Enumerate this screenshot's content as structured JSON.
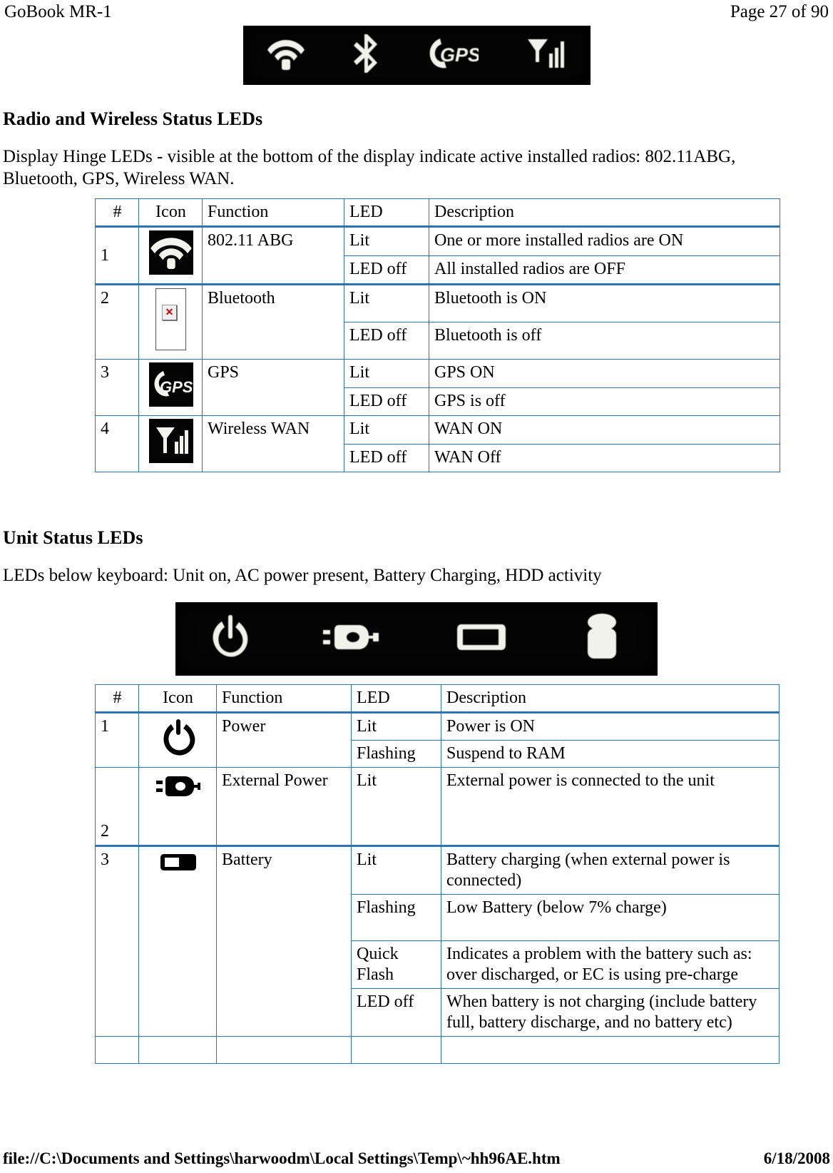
{
  "header": {
    "document_title": "GoBook MR-1",
    "page_label": "Page 27 of 90"
  },
  "sections": [
    {
      "heading": "Radio and Wireless Status LEDs",
      "intro": "Display Hinge LEDs - visible at the bottom of the display indicate active installed radios:  802.11ABG, Bluetooth, GPS, Wireless WAN.",
      "photo_strip": {
        "name": "display-hinge-led-strip",
        "icons": [
          "wifi-icon",
          "bluetooth-icon",
          "gps-icon",
          "wwan-signal-icon"
        ]
      },
      "table": {
        "columns": [
          "#",
          "Icon",
          "Function",
          "LED",
          "Description"
        ],
        "rows": [
          {
            "num": "1",
            "icon": "wifi-icon",
            "function": "802.11 ABG",
            "states": [
              {
                "led": "Lit",
                "description": "One or more installed radios are ON"
              },
              {
                "led": "LED off",
                "description": "All installed radios are OFF"
              }
            ]
          },
          {
            "num": "2",
            "icon": "broken-image-icon",
            "function": "Bluetooth",
            "states": [
              {
                "led": "Lit",
                "description": "Bluetooth is ON"
              },
              {
                "led": "LED off",
                "description": "Bluetooth is off"
              }
            ]
          },
          {
            "num": "3",
            "icon": "gps-icon",
            "function": "GPS",
            "states": [
              {
                "led": "Lit",
                "description": "GPS ON"
              },
              {
                "led": "LED off",
                "description": "GPS is off"
              }
            ]
          },
          {
            "num": "4",
            "icon": "wwan-signal-icon",
            "function": "Wireless WAN",
            "states": [
              {
                "led": "Lit",
                "description": "WAN ON"
              },
              {
                "led": "LED off",
                "description": "WAN Off"
              }
            ]
          }
        ]
      }
    },
    {
      "heading": "Unit Status LEDs",
      "intro": "LEDs below keyboard:  Unit on, AC power present, Battery Charging, HDD activity",
      "photo_strip": {
        "name": "keyboard-led-strip",
        "icons": [
          "power-icon",
          "plug-icon",
          "battery-icon",
          "hdd-icon"
        ]
      },
      "table": {
        "columns": [
          "#",
          "Icon",
          "Function",
          "LED",
          "Description"
        ],
        "rows": [
          {
            "num": "1",
            "icon": "power-icon",
            "function": "Power",
            "states": [
              {
                "led": "Lit",
                "description": "Power is ON"
              },
              {
                "led": "Flashing",
                "description": "Suspend to RAM"
              }
            ]
          },
          {
            "num": "2",
            "icon": "plug-icon",
            "function": "External Power",
            "states": [
              {
                "led": "Lit",
                "description": "External power is connected to the unit"
              }
            ]
          },
          {
            "num": "3",
            "icon": "battery-icon",
            "function": "Battery",
            "states": [
              {
                "led": "Lit",
                "description": "Battery charging (when external power is connected)"
              },
              {
                "led": "Flashing",
                "description": "Low Battery (below 7% charge)"
              },
              {
                "led": "Quick Flash",
                "description": "Indicates a problem with the battery such as: over discharged, or EC is using pre-charge"
              },
              {
                "led": "LED off",
                "description": "When battery is not charging  (include battery full, battery discharge, and no battery etc)"
              }
            ]
          }
        ]
      }
    }
  ],
  "footer": {
    "path": "file://C:\\Documents and Settings\\harwoodm\\Local Settings\\Temp\\~hh96AE.htm",
    "date": "6/18/2008"
  },
  "colors": {
    "table_border": "#2e74b5",
    "strip_background": "#040404",
    "broken_image_x": "#cc0000"
  }
}
